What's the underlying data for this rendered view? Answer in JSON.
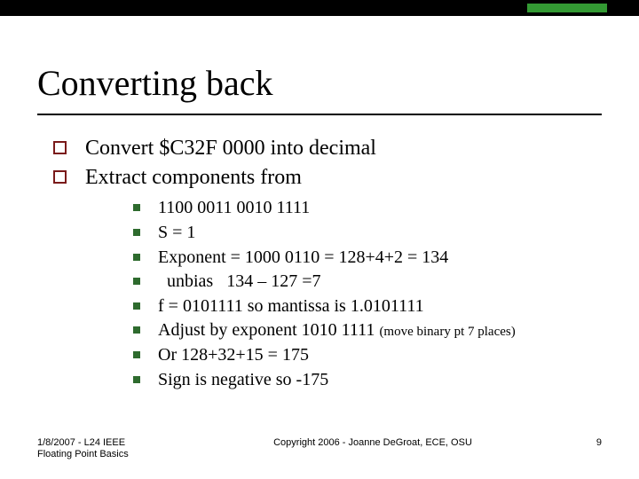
{
  "title": "Converting back",
  "bullets_lvl1": [
    "Convert $C32F 0000 into decimal",
    "Extract components from"
  ],
  "bullets_lvl2": [
    {
      "text": "1100 0011 0010 1111"
    },
    {
      "text": "S = 1"
    },
    {
      "text": "Exponent = 1000 0110 = 128+4+2 = 134"
    },
    {
      "text": "  unbias   134 – 127 =7"
    },
    {
      "text": "f = 0101111 so mantissa is 1.0101111"
    },
    {
      "text": "Adjust by exponent 1010 1111 ",
      "small": "(move binary pt 7 places)"
    },
    {
      "text": "Or 128+32+15 = 175"
    },
    {
      "text": "Sign is negative so -175"
    }
  ],
  "footer": {
    "left_line1": "1/8/2007 - L24 IEEE",
    "left_line2": "Floating Point Basics",
    "center": "Copyright 2006 - Joanne DeGroat, ECE, OSU",
    "page": "9"
  }
}
